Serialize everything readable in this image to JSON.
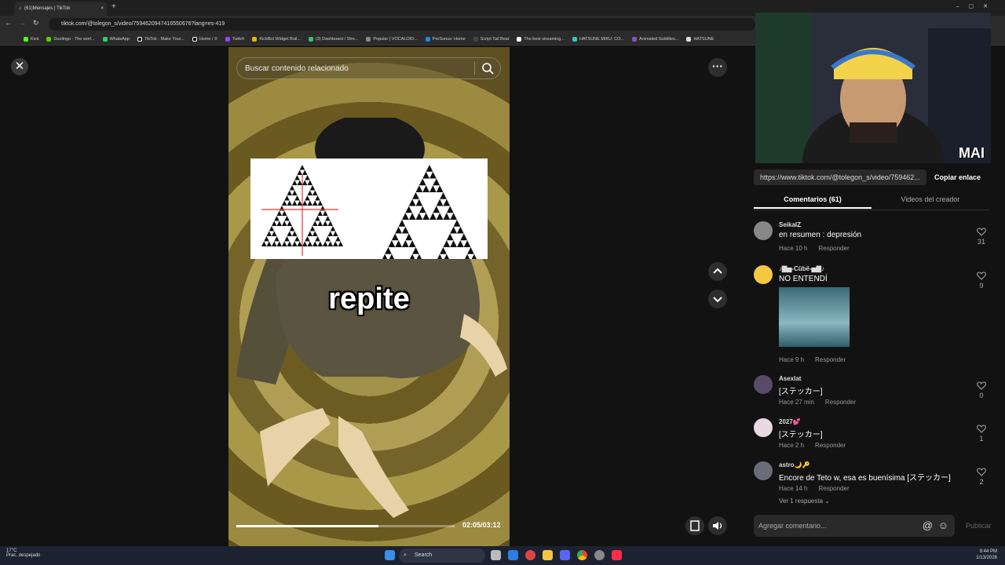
{
  "browser": {
    "tab_title": "(61)Mensajes | TikTok",
    "url": "tiktok.com/@tolegon_s/video/7594620947416550676?lang=es-419",
    "bookmarks": [
      "Kick",
      "Duolingo - The worl...",
      "WhatsApp",
      "TikTok - Make Your...",
      "Home / X",
      "Twitch",
      "KickBot Widget Buil...",
      "(3) Dashboard / Stre...",
      "Popular | VOCALOID...",
      "PreSonus: Home",
      "Script Tail Beat",
      "The best streaming...",
      "HATSUNE MIKU: CO...",
      "Animated Subtitles...",
      "HATSUNE"
    ]
  },
  "player": {
    "search_placeholder": "Buscar contenido relacionado",
    "caption": "repite",
    "time": "02:05/03:12",
    "progress": 0.65
  },
  "panel": {
    "share_url": "https://www.tiktok.com/@tolegon_s/video/759462...",
    "copy_label": "Copiar enlace",
    "tab_comments": "Comentarios (61)",
    "tab_creator": "Videos del creador",
    "webcam_label": "MAI",
    "reply_label": "Responder",
    "comments": [
      {
        "user": "SeikaIZ",
        "text": "en resumen : depresión",
        "time": "Hace 10 h",
        "likes": "31"
      },
      {
        "user": "♪▇▅-Cübë-▅▇♪",
        "text": "NO ENTENDÍ",
        "time": "Hace 9 h",
        "likes": "9"
      },
      {
        "user": "Asexlat",
        "text": "[ステッカー]",
        "time": "Hace 27 min",
        "likes": "0"
      },
      {
        "user": "2027💕",
        "text": "[ステッカー]",
        "time": "Hace 2 h",
        "likes": "1"
      },
      {
        "user": "astro🌙🔑",
        "text": "Encore de Teto w, esa es buenísima [ステッカー]",
        "time": "Hace 14 h",
        "likes": "2"
      }
    ],
    "view_replies": "Ver 1 respuesta ⌄",
    "comment_placeholder": "Agregar comentario...",
    "publish_label": "Publicar"
  },
  "taskbar": {
    "weather_temp": "17°C",
    "weather_desc": "Prac. despejado",
    "search_label": "Search",
    "time": "9:44 PM",
    "date": "1/13/2026"
  }
}
